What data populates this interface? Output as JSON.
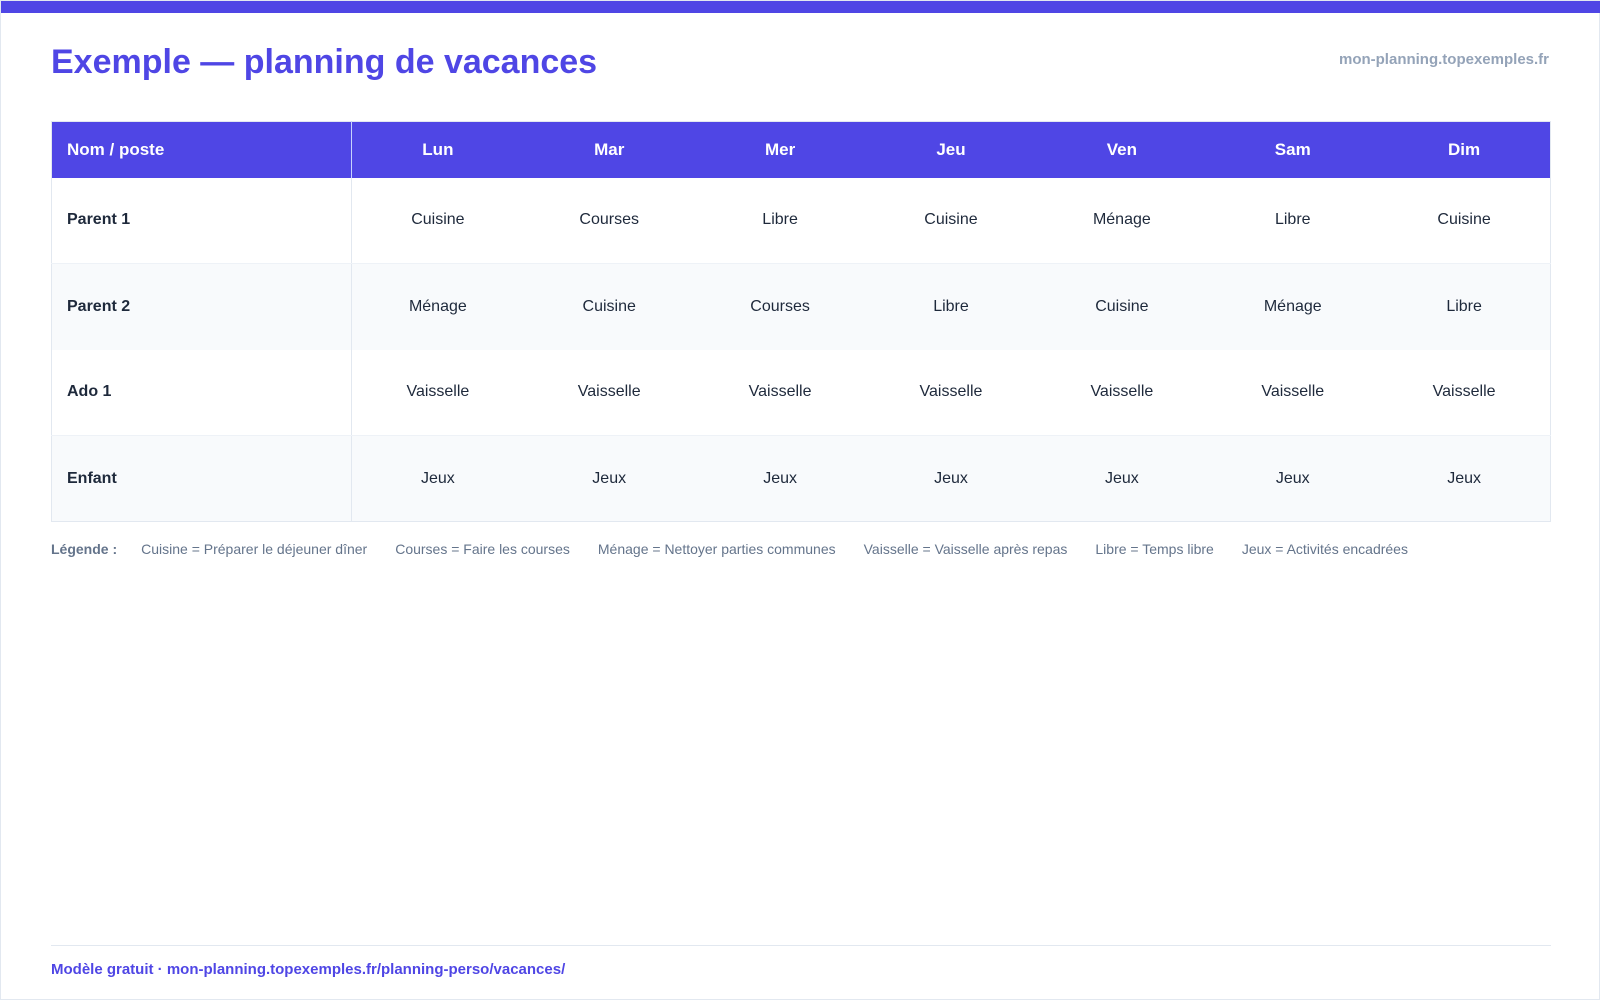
{
  "header": {
    "title": "Exemple — planning de vacances",
    "site": "mon-planning.topexemples.fr"
  },
  "table": {
    "columns": [
      "Nom / poste",
      "Lun",
      "Mar",
      "Mer",
      "Jeu",
      "Ven",
      "Sam",
      "Dim"
    ],
    "rows": [
      {
        "name": "Parent 1",
        "cells": [
          "Cuisine",
          "Courses",
          "Libre",
          "Cuisine",
          "Ménage",
          "Libre",
          "Cuisine"
        ]
      },
      {
        "name": "Parent 2",
        "cells": [
          "Ménage",
          "Cuisine",
          "Courses",
          "Libre",
          "Cuisine",
          "Ménage",
          "Libre"
        ]
      },
      {
        "name": "Ado 1",
        "cells": [
          "Vaisselle",
          "Vaisselle",
          "Vaisselle",
          "Vaisselle",
          "Vaisselle",
          "Vaisselle",
          "Vaisselle"
        ]
      },
      {
        "name": "Enfant",
        "cells": [
          "Jeux",
          "Jeux",
          "Jeux",
          "Jeux",
          "Jeux",
          "Jeux",
          "Jeux"
        ]
      }
    ]
  },
  "legend": {
    "label": "Légende :",
    "items": [
      "Cuisine = Préparer le déjeuner dîner",
      "Courses = Faire les courses",
      "Ménage = Nettoyer parties communes",
      "Vaisselle = Vaisselle après repas",
      "Libre = Temps libre",
      "Jeux = Activités encadrées"
    ]
  },
  "footer": {
    "text": "Modèle gratuit · mon-planning.topexemples.fr/planning-perso/vacances/"
  },
  "colors": {
    "accent": "#4f46e5",
    "muted": "#94a3b8"
  }
}
